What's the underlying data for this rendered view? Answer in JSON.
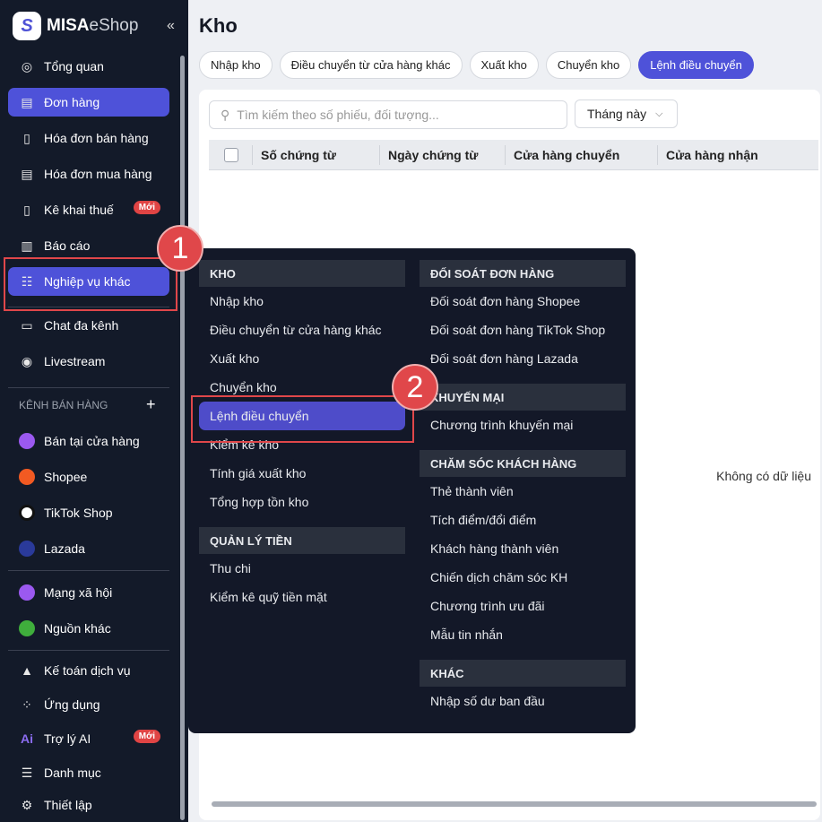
{
  "brand": {
    "name_bold": "MISA",
    "name_light": "eShop",
    "collapse": "«"
  },
  "sidebar": {
    "items": [
      {
        "label": "Tổng quan",
        "icon": "◎"
      },
      {
        "label": "Đơn hàng",
        "icon": "▤"
      },
      {
        "label": "Hóa đơn bán hàng",
        "icon": "▯"
      },
      {
        "label": "Hóa đơn mua hàng",
        "icon": "▤"
      },
      {
        "label": "Kê khai thuế",
        "icon": "▯",
        "badge": "Mới"
      },
      {
        "label": "Báo cáo",
        "icon": "▥"
      },
      {
        "label": "Nghiệp vụ khác",
        "icon": "☷"
      },
      {
        "label": "Chat đa kênh",
        "icon": "▭"
      },
      {
        "label": "Livestream",
        "icon": "◉"
      }
    ],
    "section_label": "KÊNH BÁN HÀNG",
    "section_add": "+",
    "channels": [
      {
        "label": "Bán tại cửa hàng",
        "color": "#9b59f0"
      },
      {
        "label": "Shopee",
        "color": "#f25a22"
      },
      {
        "label": "TikTok Shop",
        "color": "#ffffff"
      },
      {
        "label": "Lazada",
        "color": "#2a3a9a"
      },
      {
        "label": "Mạng xã hội",
        "color": "#9b59f0"
      },
      {
        "label": "Nguồn khác",
        "color": "#3fae3c"
      }
    ],
    "bottom": [
      {
        "label": "Kế toán dịch vụ",
        "icon": "▲"
      },
      {
        "label": "Ứng dụng",
        "icon": "⁘"
      },
      {
        "label": "Trợ lý AI",
        "icon": "Ai",
        "badge": "Mới"
      },
      {
        "label": "Danh mục",
        "icon": "☰"
      },
      {
        "label": "Thiết lập",
        "icon": "⚙"
      }
    ]
  },
  "main": {
    "title": "Kho",
    "tabs": [
      "Nhập kho",
      "Điều chuyển từ cửa hàng khác",
      "Xuất kho",
      "Chuyển kho",
      "Lệnh điều chuyển"
    ],
    "search_placeholder": "Tìm kiếm theo số phiếu, đối tượng...",
    "period": "Tháng này",
    "columns": [
      "Số chứng từ",
      "Ngày chứng từ",
      "Cửa hàng chuyển",
      "Cửa hàng nhận"
    ],
    "empty": "Không có dữ liệu"
  },
  "menu": {
    "left": [
      {
        "header": "KHO",
        "items": [
          "Nhập kho",
          "Điều chuyển từ cửa hàng khác",
          "Xuất kho",
          "Chuyển kho",
          "Lệnh điều chuyển",
          "Kiểm kê kho",
          "Tính giá xuất kho",
          "Tổng hợp tồn kho"
        ]
      },
      {
        "header": "QUẢN LÝ TIỀN",
        "items": [
          "Thu chi",
          "Kiểm kê quỹ tiền mặt"
        ]
      }
    ],
    "right": [
      {
        "header": "ĐỐI SOÁT ĐƠN HÀNG",
        "items": [
          "Đối soát đơn hàng Shopee",
          "Đối soát đơn hàng TikTok Shop",
          "Đối soát đơn hàng Lazada"
        ]
      },
      {
        "header": "KHUYẾN MẠI",
        "items": [
          "Chương trình khuyến mại"
        ]
      },
      {
        "header": "CHĂM SÓC KHÁCH HÀNG",
        "items": [
          "Thẻ thành viên",
          "Tích điểm/đổi điểm",
          "Khách hàng thành viên",
          "Chiến dịch chăm sóc KH",
          "Chương trình ưu đãi",
          "Mẫu tin nhắn"
        ]
      },
      {
        "header": "KHÁC",
        "items": [
          "Nhập số dư ban đầu"
        ]
      }
    ],
    "selected": "Lệnh điều chuyển"
  },
  "annotations": [
    "1",
    "2"
  ]
}
